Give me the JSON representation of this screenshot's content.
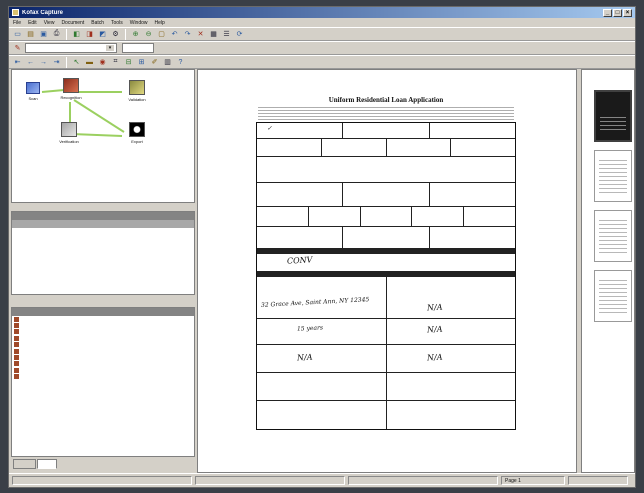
{
  "app": {
    "title": "Kofax Capture",
    "close_glyph": "×",
    "maximize_glyph": "□",
    "minimize_glyph": "_"
  },
  "menu": [
    "File",
    "Edit",
    "View",
    "Document",
    "Batch",
    "Tools",
    "Window",
    "Help"
  ],
  "workflow": {
    "nodes": [
      {
        "label": "Scan",
        "icon": "scanner-icon"
      },
      {
        "label": "Recognition",
        "icon": "recognition-icon"
      },
      {
        "label": "Validation",
        "icon": "validation-icon"
      },
      {
        "label": "Verification",
        "icon": "verification-icon"
      },
      {
        "label": "Export",
        "icon": "export-icon"
      }
    ]
  },
  "document": {
    "title": "Uniform Residential Loan Application",
    "handwriting": [
      "CONV",
      "32 Grace Ave, Saint Ann, NY 12345",
      "15 years",
      "N/A"
    ]
  },
  "thumbnails": {
    "count": 4,
    "selected": 0
  },
  "statusbar": {
    "page": "Page 1"
  }
}
